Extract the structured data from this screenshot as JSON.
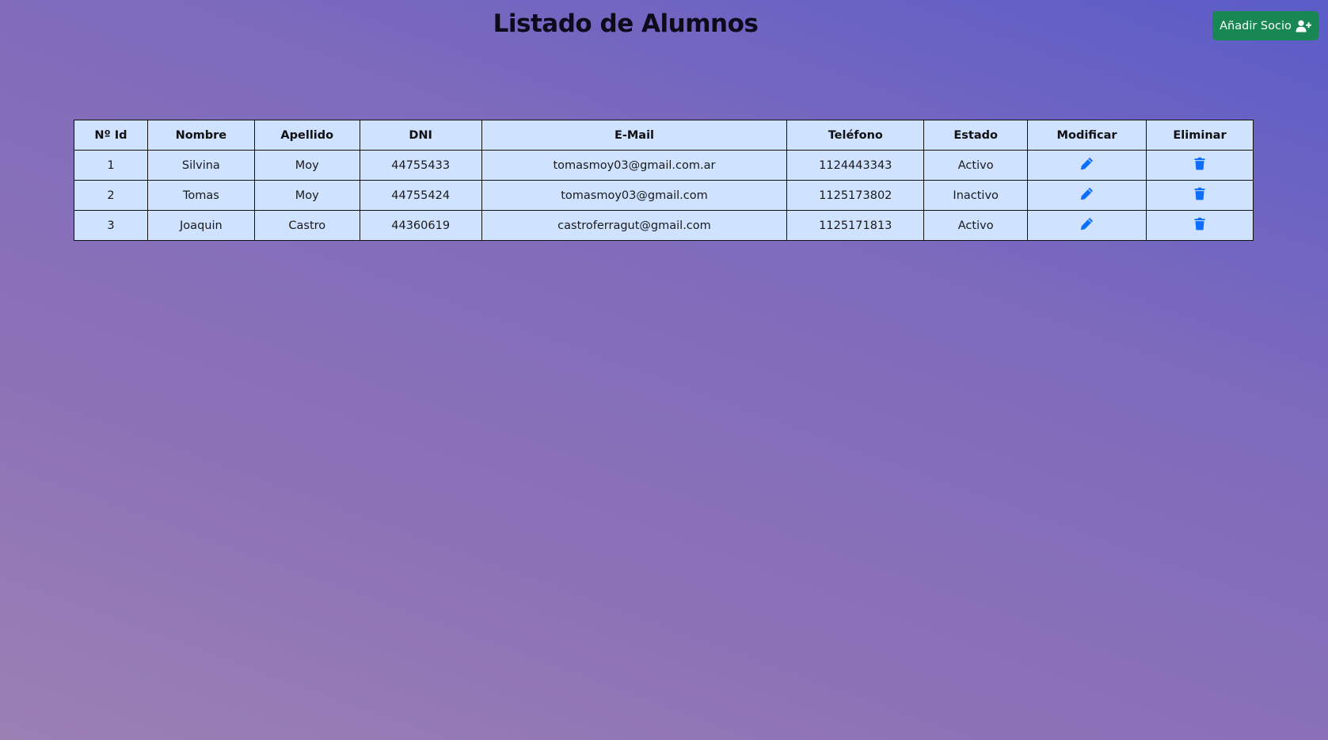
{
  "header": {
    "title": "Listado de Alumnos",
    "add_button_label": "Añadir Socio",
    "add_button_icon": "user-plus-icon"
  },
  "table": {
    "columns": [
      "Nº Id",
      "Nombre",
      "Apellido",
      "DNI",
      "E-Mail",
      "Teléfono",
      "Estado",
      "Modificar",
      "Eliminar"
    ],
    "rows": [
      {
        "id": "1",
        "nombre": "Silvina",
        "apellido": "Moy",
        "dni": "44755433",
        "email": "tomasmoy03@gmail.com.ar",
        "telefono": "1124443343",
        "estado": "Activo"
      },
      {
        "id": "2",
        "nombre": "Tomas",
        "apellido": "Moy",
        "dni": "44755424",
        "email": "tomasmoy03@gmail.com",
        "telefono": "1125173802",
        "estado": "Inactivo"
      },
      {
        "id": "3",
        "nombre": "Joaquin",
        "apellido": "Castro",
        "dni": "44360619",
        "email": "castroferragut@gmail.com",
        "telefono": "1125171813",
        "estado": "Activo"
      }
    ],
    "edit_icon": "pencil-icon",
    "delete_icon": "trash-icon"
  },
  "colors": {
    "button_green": "#198754",
    "table_bg": "#cfe2ff",
    "icon_blue": "#0d6efd"
  }
}
